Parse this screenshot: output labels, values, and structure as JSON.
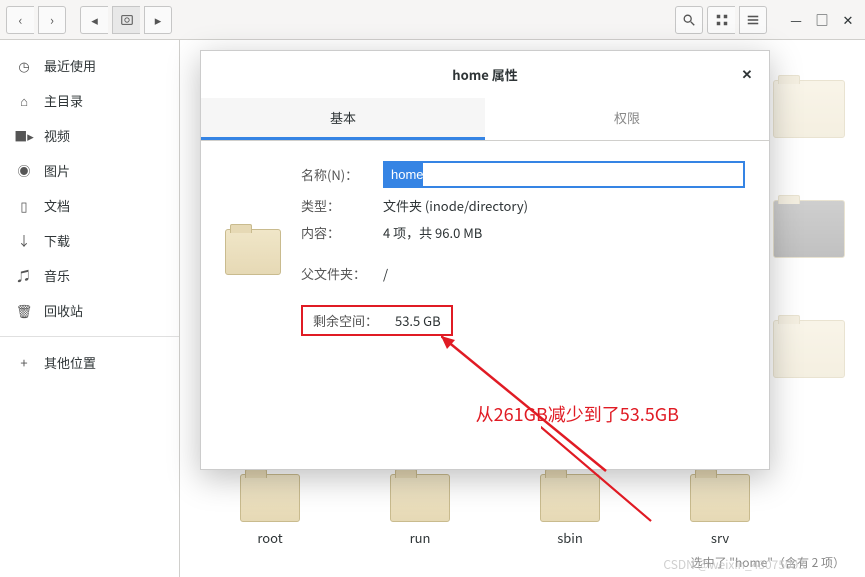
{
  "toolbar": {
    "back": "‹",
    "forward": "›"
  },
  "sidebar": {
    "items": [
      {
        "icon": "clock",
        "label": "最近使用"
      },
      {
        "icon": "home",
        "label": "主目录"
      },
      {
        "icon": "video",
        "label": "视频"
      },
      {
        "icon": "photo",
        "label": "图片"
      },
      {
        "icon": "doc",
        "label": "文档"
      },
      {
        "icon": "download",
        "label": "下载"
      },
      {
        "icon": "music",
        "label": "音乐"
      },
      {
        "icon": "trash",
        "label": "回收站"
      }
    ],
    "other": {
      "icon": "plus",
      "label": "其他位置"
    }
  },
  "dialog": {
    "title": "home 属性",
    "tabs": {
      "basic": "基本",
      "perm": "权限"
    },
    "name_label": "名称(N)：",
    "name_value": "home",
    "type_label": "类型：",
    "type_value": "文件夹 (inode/directory)",
    "content_label": "内容：",
    "content_value": "4 项，共 96.0 MB",
    "parent_label": "父文件夹：",
    "parent_value": "/",
    "free_label": "剩余空间：",
    "free_value": "53.5 GB"
  },
  "folders": [
    "root",
    "run",
    "sbin",
    "srv"
  ],
  "annotation": "从261GB减少到了53.5GB",
  "status": "选中了 \"home\"（含有 2 项）",
  "watermark": "CSDN @weixin_43075093"
}
